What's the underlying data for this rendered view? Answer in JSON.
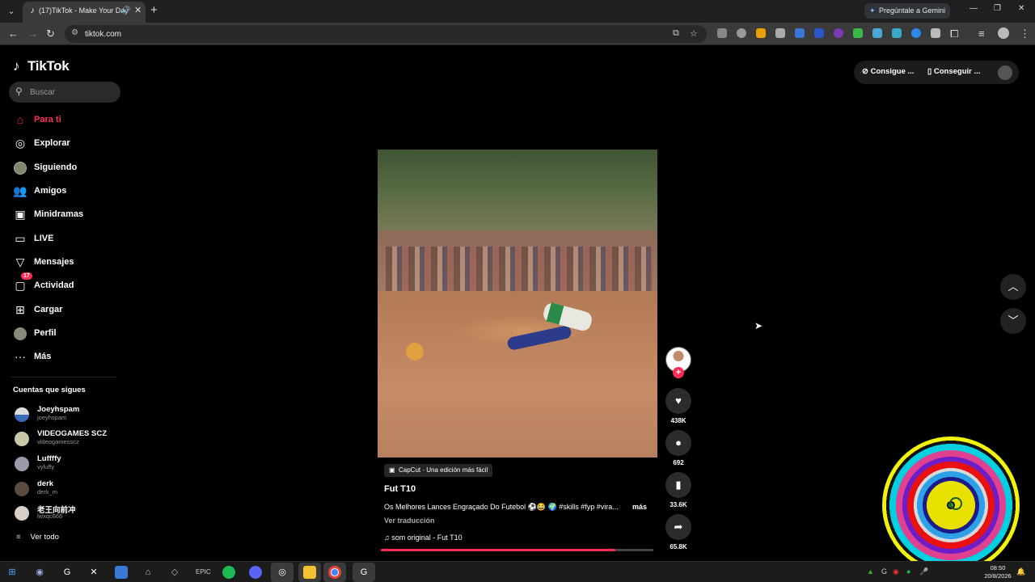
{
  "browser": {
    "tab": {
      "title": "(17)TikTok - Make Your Day"
    },
    "gemini_label": "Pregúntale a Gemini",
    "url": "tiktok.com"
  },
  "tiktok": {
    "logo": "TikTok",
    "search_placeholder": "Buscar",
    "nav": [
      {
        "label": "Para ti",
        "icon": "home-icon"
      },
      {
        "label": "Explorar",
        "icon": "compass-icon"
      },
      {
        "label": "Siguiendo",
        "icon": "following-avatar-icon"
      },
      {
        "label": "Amigos",
        "icon": "friends-icon"
      },
      {
        "label": "Minidramas",
        "icon": "minidramas-icon"
      },
      {
        "label": "LIVE",
        "icon": "live-tv-icon"
      },
      {
        "label": "Mensajes",
        "icon": "send-icon"
      },
      {
        "label": "Actividad",
        "icon": "activity-icon",
        "badge": "17"
      },
      {
        "label": "Cargar",
        "icon": "upload-icon"
      },
      {
        "label": "Perfil",
        "icon": "profile-avatar-icon"
      },
      {
        "label": "Más",
        "icon": "more-dots-icon"
      }
    ],
    "following_title": "Cuentas que sigues",
    "following": [
      {
        "name": "Joeyhspam",
        "handle": "joeyhspam"
      },
      {
        "name": "VIDEOGAMES SCZ",
        "handle": "videogamesscz"
      },
      {
        "name": "Luffffy",
        "handle": "vyluffy"
      },
      {
        "name": "derk",
        "handle": "derk_m"
      },
      {
        "name": "老王向前冲",
        "handle": "lwxqc666"
      }
    ],
    "see_all": "Ver todo",
    "top_right": {
      "coins": "Consigue ...",
      "app": "Conseguir ..."
    }
  },
  "video": {
    "capcut": "CapCut · Una edición más fácil",
    "title": "Fut T10",
    "description": "Os Melhores Lances Engraçado Do Futebol ⚽😂 🌍 #skills #fyp #vira...",
    "more": "más",
    "translate": "Ver traducción",
    "sound": "som original - Fut T10",
    "progress": 0.86,
    "likes": "438K",
    "comments": "692",
    "saves": "33.6K",
    "shares": "65.8K"
  },
  "taskbar": {
    "time": "08:50",
    "date": "20/8/2026"
  },
  "colors": {
    "accent": "#fe2c55",
    "background": "#000000"
  }
}
